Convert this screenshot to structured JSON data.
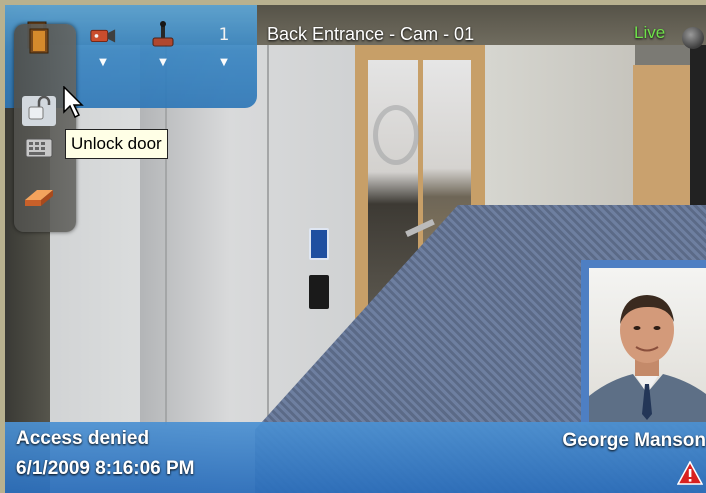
{
  "camera": {
    "title": "Back Entrance - Cam - 01",
    "live_label": "Live"
  },
  "toolbar": {
    "items": [
      {
        "icon": "door-icon"
      },
      {
        "icon": "camera-icon"
      },
      {
        "icon": "joystick-icon"
      },
      {
        "icon": "number-1",
        "label": "1"
      }
    ]
  },
  "door_menu": {
    "items": [
      {
        "icon": "door-icon"
      },
      {
        "icon": "padlock-unlock-icon",
        "active": true
      },
      {
        "icon": "keypad-icon"
      },
      {
        "icon": "eraser-icon"
      }
    ]
  },
  "tooltip": {
    "text": "Unlock door"
  },
  "event": {
    "status": "Access denied",
    "timestamp": "6/1/2009 8:16:06 PM",
    "person_name": "George Manson",
    "warning_icon": "warning-icon"
  },
  "colors": {
    "toolbar_blue": "#3a86c2",
    "live_green": "#6fe14a",
    "status_bar_blue": "#3f86c9",
    "frame_border": "#b8b18f",
    "warning_red": "#d82020"
  }
}
